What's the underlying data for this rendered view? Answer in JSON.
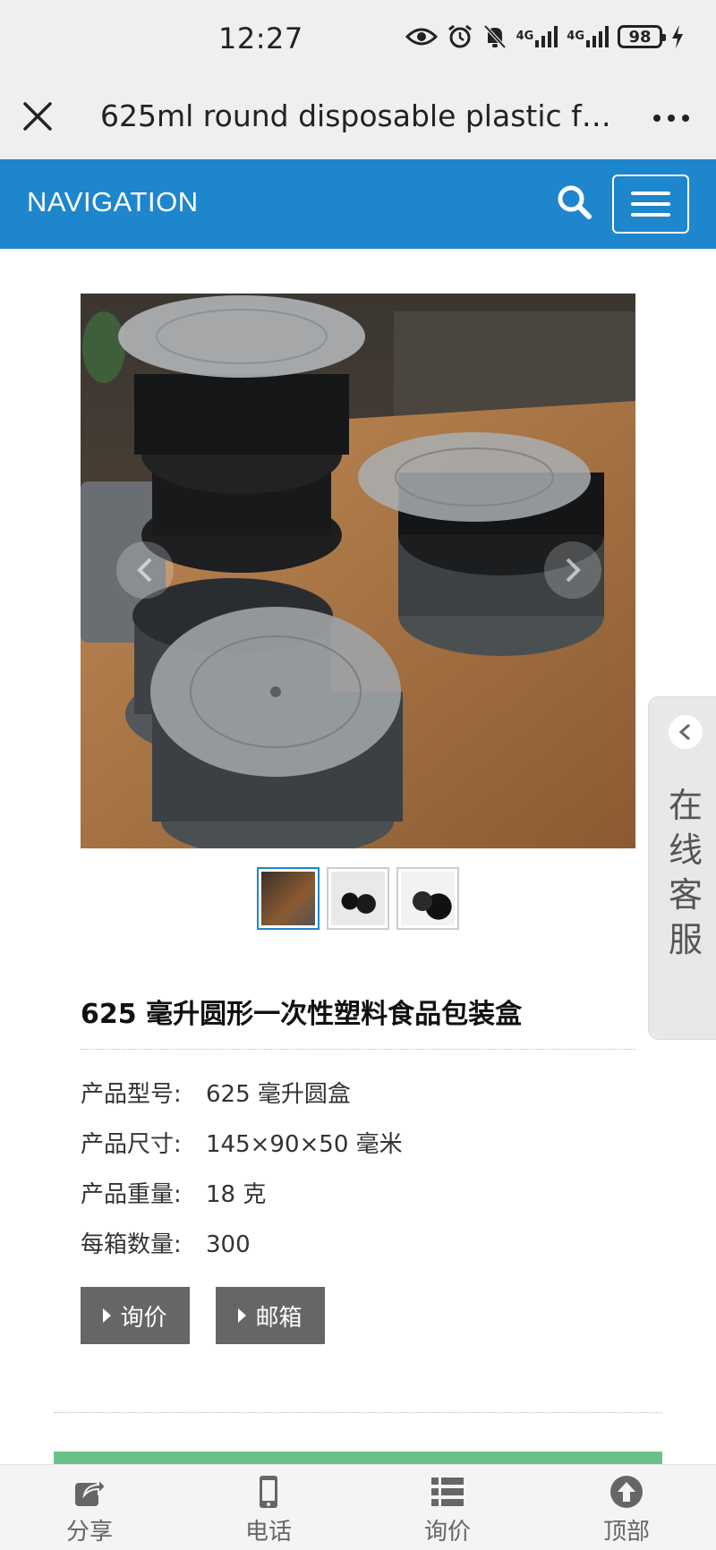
{
  "status_bar": {
    "time": "12:27",
    "network_1": "4G",
    "network_2": "4G",
    "battery": "98"
  },
  "browser": {
    "page_title": "625ml round disposable plastic foo...",
    "close_icon": "close-icon",
    "more_icon": "more-dots-icon"
  },
  "nav": {
    "label": "NAVIGATION",
    "search_icon": "search-icon",
    "menu_icon": "hamburger-menu-icon",
    "bg_color": "#1e86cc"
  },
  "gallery": {
    "thumb_count": 3,
    "active_index": 0
  },
  "product": {
    "title": "625 毫升圆形一次性塑料食品包装盒",
    "specs": [
      {
        "label": "产品型号:",
        "value": "625 毫升圆盒"
      },
      {
        "label": "产品尺寸:",
        "value": "145×90×50 毫米"
      },
      {
        "label": "产品重量:",
        "value": "18 克"
      },
      {
        "label": "每箱数量:",
        "value": "300"
      }
    ],
    "buttons": {
      "inquiry": "询价",
      "email": "邮箱"
    }
  },
  "side_tab": {
    "label": "在线客服"
  },
  "bottom_bar": {
    "items": [
      {
        "label": "分享",
        "icon": "share-icon"
      },
      {
        "label": "电话",
        "icon": "phone-icon"
      },
      {
        "label": "询价",
        "icon": "list-icon"
      },
      {
        "label": "顶部",
        "icon": "arrow-up-icon"
      }
    ]
  }
}
